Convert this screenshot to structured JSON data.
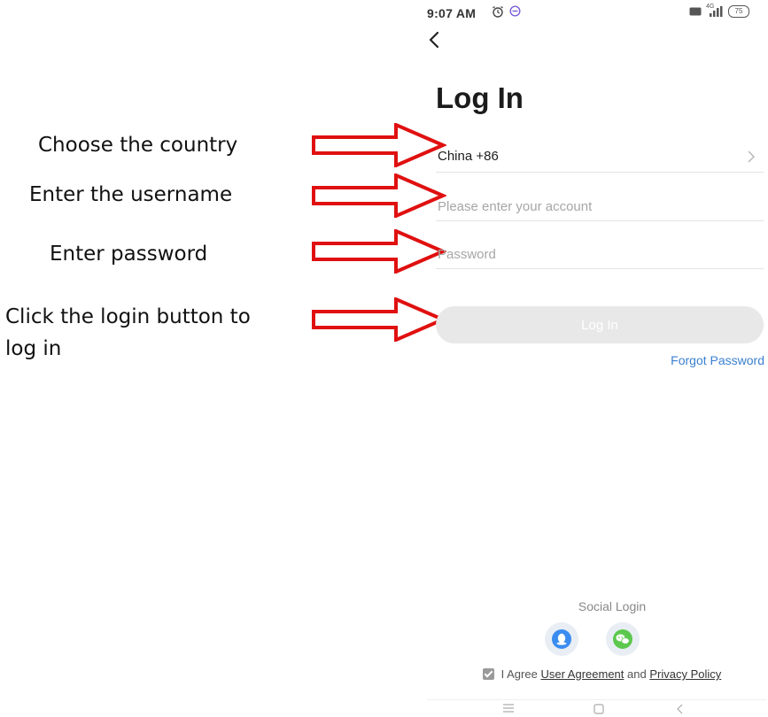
{
  "annotations": {
    "country": "Choose the country",
    "username": "Enter the username",
    "password": "Enter password",
    "login_line1": "Click the login button to",
    "login_line2": "log in"
  },
  "status_bar": {
    "time": "9:07 AM",
    "signal": "4G",
    "battery": "75"
  },
  "page": {
    "title": "Log In"
  },
  "form": {
    "country": "China +86",
    "account_placeholder": "Please enter your account",
    "password_placeholder": "Password",
    "login_button": "Log In",
    "forgot_password": "Forgot Password"
  },
  "social": {
    "label": "Social Login",
    "icons": [
      "qq-icon",
      "wechat-icon"
    ]
  },
  "agreement": {
    "prefix": "I Agree",
    "user_agreement": "User Agreement",
    "and": "and",
    "privacy_policy": "Privacy Policy"
  },
  "colors": {
    "arrow": "#e01010",
    "link": "#3a7fd0",
    "login_button_bg": "#e8e8e8",
    "qq": "#3b8cf0",
    "wechat": "#5cc84e"
  }
}
